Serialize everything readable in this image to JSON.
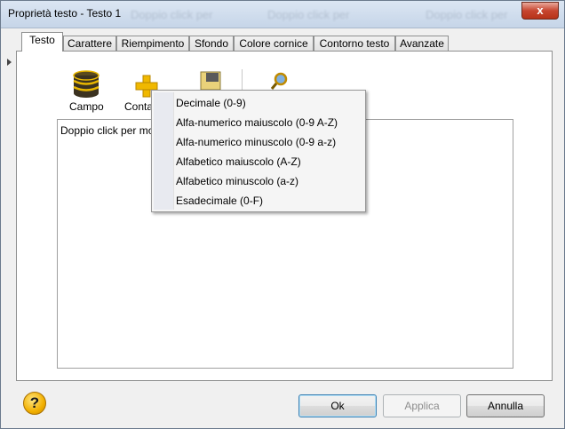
{
  "window": {
    "title": "Proprietà testo - Testo 1",
    "close_label": "x",
    "background_ghost": [
      "Doppio click per",
      "Doppio click per",
      "Doppio click per"
    ]
  },
  "tabs": [
    {
      "label": "Testo",
      "active": true
    },
    {
      "label": "Carattere"
    },
    {
      "label": "Riempimento"
    },
    {
      "label": "Sfondo"
    },
    {
      "label": "Colore cornice"
    },
    {
      "label": "Contorno testo"
    },
    {
      "label": "Avanzate"
    }
  ],
  "toolbar": {
    "campo_label": "Campo",
    "contatore_label": "Conta"
  },
  "text_area": {
    "content": "Doppio click per mo"
  },
  "context_menu": {
    "items": [
      "Decimale (0-9)",
      "Alfa-numerico maiuscolo (0-9 A-Z)",
      "Alfa-numerico minuscolo (0-9 a-z)",
      "Alfabetico maiuscolo (A-Z)",
      "Alfabetico minuscolo (a-z)",
      "Esadecimale (0-F)"
    ]
  },
  "buttons": {
    "ok": "Ok",
    "applica": "Applica",
    "annulla": "Annulla",
    "applica_enabled": false
  },
  "help_icon_glyph": "?",
  "icons": [
    "database-icon",
    "counter-plus-icon",
    "image-icon",
    "magnifier-icon",
    "help-icon"
  ]
}
